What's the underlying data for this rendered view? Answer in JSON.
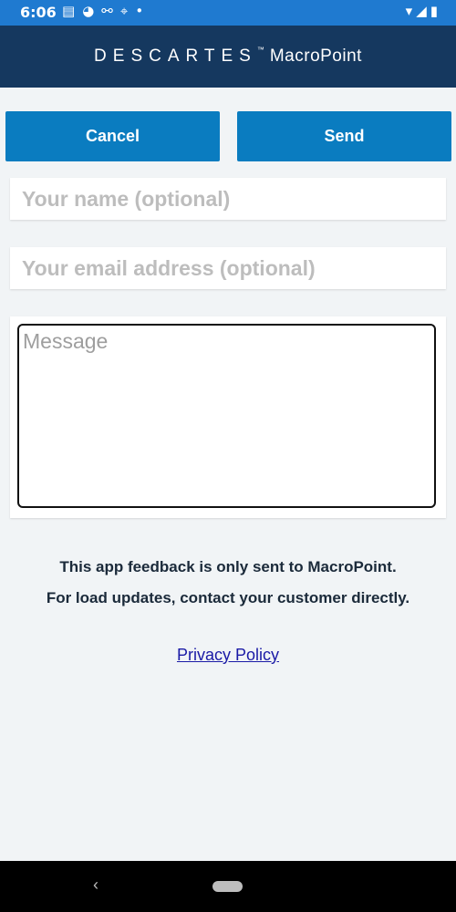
{
  "status_bar": {
    "time": "6:06",
    "left_icons": [
      "news-icon",
      "app-icon",
      "network-icon",
      "location-icon",
      "dot-icon"
    ],
    "right_icons": [
      "wifi-icon",
      "signal-icon",
      "battery-icon"
    ]
  },
  "app_bar": {
    "brand": "DESCARTES",
    "trademark": "™",
    "product": "MacroPoint"
  },
  "buttons": {
    "cancel_label": "Cancel",
    "send_label": "Send"
  },
  "form": {
    "name_placeholder": "Your name (optional)",
    "email_placeholder": "Your email address (optional)",
    "message_placeholder": "Message"
  },
  "notice": {
    "line1": "This app feedback is only sent to MacroPoint.",
    "line2": "For load updates, contact your customer directly."
  },
  "links": {
    "privacy_policy": "Privacy Policy"
  },
  "colors": {
    "status_bar": "#1f7ad0",
    "app_bar": "#15385f",
    "button": "#0a7cc0",
    "background": "#f1f4f6",
    "link": "#1a1aa6"
  }
}
